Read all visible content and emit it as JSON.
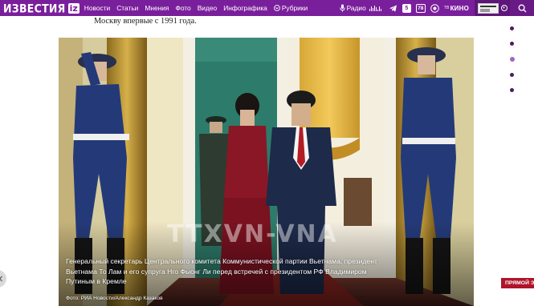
{
  "header": {
    "logo_text": "ИЗВЕСТИЯ",
    "logo_iz": "iz",
    "nav": [
      "Новости",
      "Статьи",
      "Мнения",
      "Фото",
      "Видео",
      "Инфографика"
    ],
    "rubrics_label": "Рубрики",
    "radio_label": "Радио",
    "icons": [
      "mic-icon",
      "equalizer-icon",
      "telegram-icon",
      "tv5-icon",
      "seventy-eight-icon",
      "vk-icon",
      "kino-icon",
      "newspaper-icon",
      "search-icon"
    ],
    "tv5_label": "5",
    "seventy_eight_label": "78",
    "kino_label": "КИНО",
    "kino_small": "ТВ"
  },
  "article": {
    "intro_text": "Москву впервые с 1991 года.",
    "photo": {
      "caption": "Генеральный секретарь Центрального комитета Коммунистической партии Вьетнама, президент Вьетнама То Лам и его супруга Нго Фыонг Ли перед встречей с президентом РФ Владимиром Путиным в Кремле",
      "credit": "Фото: РИА Новости/Александр Казаков",
      "watermark": "TTXVN-VNA"
    }
  },
  "side_dots": {
    "count": 5,
    "active_index": 2
  },
  "live_badge": "ПРЯМОЙ ЭФ",
  "colors": {
    "brand_purple": "#7a1f9c",
    "live_red": "#b0142a",
    "dot_dark": "#4b1b63",
    "dot_active": "#a763c6"
  }
}
